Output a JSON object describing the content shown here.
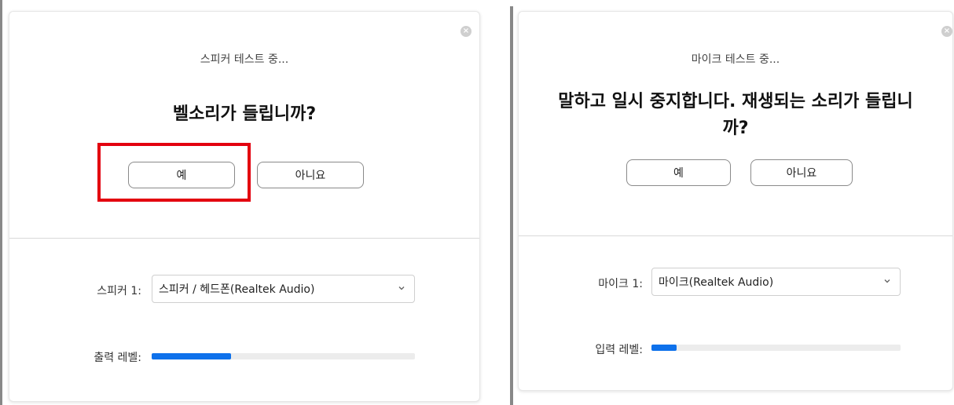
{
  "speaker_panel": {
    "status": "스피커 테스트 중...",
    "question": "벨소리가 들립니까?",
    "yes_label": "예",
    "no_label": "아니요",
    "device_label": "스피커 1:",
    "device_value": "스피커 / 헤드폰(Realtek Audio)",
    "level_label": "출력 레벨:",
    "level_fraction": 0.3
  },
  "mic_panel": {
    "status": "마이크 테스트 중...",
    "question_line1": "말하고 일시 중지합니다. 재생되는 소리가 들립니",
    "question_line2": "까?",
    "yes_label": "예",
    "no_label": "아니요",
    "device_label": "마이크 1:",
    "device_value": "마이크(Realtek Audio)",
    "level_label": "입력 레벨:",
    "level_fraction": 0.1
  },
  "colors": {
    "level_fill": "#0e71eb",
    "highlight_box": "#e3000f"
  },
  "icons": {
    "close": "close-icon",
    "dropdown": "chevron-down-icon"
  }
}
